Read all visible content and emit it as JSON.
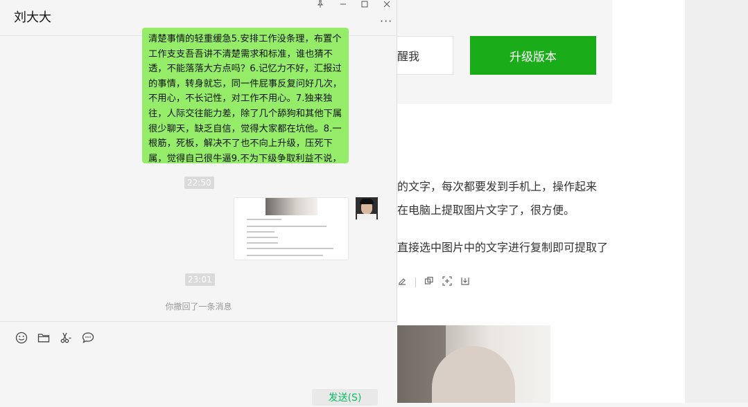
{
  "chat": {
    "title": "刘大大",
    "window_controls": {
      "pin": "⊥",
      "minimize": "—",
      "maximize": "☐",
      "close": "✕"
    },
    "more": "···",
    "message_text": "清楚事情的轻重缓急5.安排工作没条理，布置个工作支支吾吾讲不清楚需求和标准，谁也猜不透，不能落落大方点吗？6.记忆力不好，汇报过的事情，转身就忘，同一件屁事反复问好几次，不用心，不长记性，对工作不用心。7.独来独往，人际交往能力差，除了几个舔狗和其他下属很少聊天，缺乏自信，觉得大家都在坑他。8.一根筋，死板，解决不了也不向上升级，压死下属，觉得自己很牛逼9.不为下级争取利益不说，经常给下属带来烦恼，发出去的邮件也不看，",
    "timestamps": [
      "22:50",
      "23:01"
    ],
    "recall_notice": "你撤回了一条消息",
    "send_label": "发送(S)",
    "toolbar_icons": [
      "emoji-icon",
      "folder-icon",
      "scissors-icon",
      "chat-bubble-icon"
    ]
  },
  "background": {
    "remind_label": "醒我",
    "upgrade_label": "升级版本",
    "lines": [
      "的文字，每次都要发到手机上，操作起来",
      "在电脑上提取图片文字了，很方便。",
      "直接选中图片中的文字进行复制即可提取了"
    ]
  },
  "colors": {
    "bubble": "#95ec69",
    "upgrade": "#1aad19",
    "send_text": "#07c160"
  }
}
